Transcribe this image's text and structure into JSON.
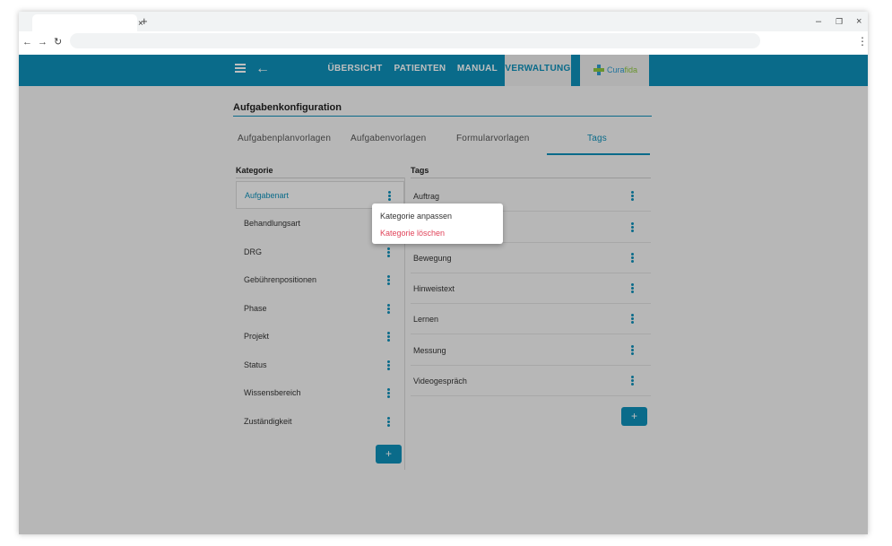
{
  "browser": {
    "tab_close": "×",
    "new_tab": "+",
    "minimize": "–",
    "restore": "❐",
    "close": "×",
    "back": "←",
    "forward": "→",
    "reload": "↻",
    "menu": "⋮"
  },
  "appbar": {
    "nav": [
      "ÜBERSICHT",
      "PATIENTEN",
      "MANUAL",
      "VERWALTUNG"
    ],
    "active_nav": "VERWALTUNG",
    "logo_part1": "Cura",
    "logo_part2": "fida",
    "colors": {
      "primary": "#0e8fb8",
      "logo_blue": "#2e9bd0",
      "logo_green": "#8cc63f",
      "danger": "#e0445a"
    }
  },
  "page": {
    "title": "Aufgabenkonfiguration",
    "subtabs": [
      "Aufgabenplanvorlagen",
      "Aufgabenvorlagen",
      "Formularvorlagen",
      "Tags"
    ],
    "active_subtab": "Tags"
  },
  "categories": {
    "header": "Kategorie",
    "items": [
      "Aufgabenart",
      "Behandlungsart",
      "DRG",
      "Gebührenpositionen",
      "Phase",
      "Projekt",
      "Status",
      "Wissensbereich",
      "Zuständigkeit"
    ],
    "selected": "Aufgabenart",
    "add_label": "+"
  },
  "tags": {
    "header": "Tags",
    "items": [
      "Auftrag",
      "",
      "Bewegung",
      "Hinweistext",
      "Lernen",
      "Messung",
      "Videogespräch"
    ],
    "add_label": "+"
  },
  "context_menu": {
    "edit": "Kategorie anpassen",
    "delete": "Kategorie löschen"
  }
}
